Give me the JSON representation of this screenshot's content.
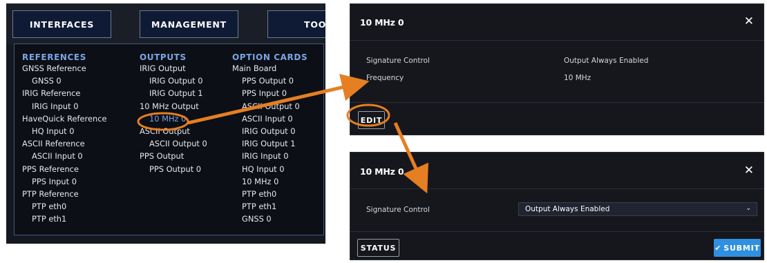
{
  "nav": {
    "tabs": [
      "INTERFACES",
      "MANAGEMENT",
      "TOO"
    ],
    "columns": [
      {
        "header": "REFERENCES",
        "items": [
          {
            "label": "GNSS Reference",
            "indent": false
          },
          {
            "label": "GNSS 0",
            "indent": true
          },
          {
            "label": "IRIG Reference",
            "indent": false
          },
          {
            "label": "IRIG Input 0",
            "indent": true
          },
          {
            "label": "HaveQuick Reference",
            "indent": false
          },
          {
            "label": "HQ Input 0",
            "indent": true
          },
          {
            "label": "ASCII Reference",
            "indent": false
          },
          {
            "label": "ASCII Input 0",
            "indent": true
          },
          {
            "label": "PPS Reference",
            "indent": false
          },
          {
            "label": "PPS Input 0",
            "indent": true
          },
          {
            "label": "PTP Reference",
            "indent": false
          },
          {
            "label": "PTP eth0",
            "indent": true
          },
          {
            "label": "PTP eth1",
            "indent": true
          }
        ]
      },
      {
        "header": "OUTPUTS",
        "items": [
          {
            "label": "IRIG Output",
            "indent": false
          },
          {
            "label": "IRIG Output 0",
            "indent": true
          },
          {
            "label": "IRIG Output 1",
            "indent": true
          },
          {
            "label": "10 MHz Output",
            "indent": false
          },
          {
            "label": "10 MHz 0",
            "indent": true,
            "active": true
          },
          {
            "label": "ASCII Output",
            "indent": false
          },
          {
            "label": "ASCII Output 0",
            "indent": true
          },
          {
            "label": "PPS Output",
            "indent": false
          },
          {
            "label": "PPS Output 0",
            "indent": true
          }
        ]
      },
      {
        "header": "OPTION CARDS",
        "items": [
          {
            "label": "Main Board",
            "indent": false
          },
          {
            "label": "PPS Output 0",
            "indent": true
          },
          {
            "label": "PPS Input 0",
            "indent": true
          },
          {
            "label": "ASCII Output 0",
            "indent": true
          },
          {
            "label": "ASCII Input 0",
            "indent": true
          },
          {
            "label": "IRIG Output 0",
            "indent": true
          },
          {
            "label": "IRIG Output 1",
            "indent": true
          },
          {
            "label": "IRIG Input 0",
            "indent": true
          },
          {
            "label": "HQ Input 0",
            "indent": true
          },
          {
            "label": "10 MHz 0",
            "indent": true
          },
          {
            "label": "PTP eth0",
            "indent": true
          },
          {
            "label": "PTP eth1",
            "indent": true
          },
          {
            "label": "GNSS 0",
            "indent": true
          }
        ]
      }
    ]
  },
  "view_dialog": {
    "title": "10 MHz 0",
    "close": "✕",
    "rows": [
      {
        "label": "Signature Control",
        "value": "Output Always Enabled"
      },
      {
        "label": "Frequency",
        "value": "10 MHz"
      }
    ],
    "edit_label": "EDIT"
  },
  "edit_dialog": {
    "title": "10 MHz 0",
    "close": "✕",
    "field_label": "Signature Control",
    "field_value": "Output Always Enabled",
    "chevron": "⌄",
    "status_label": "STATUS",
    "submit_label": "SUBMIT",
    "submit_icon": "✔"
  },
  "colors": {
    "accent_orange": "#e67e22",
    "nav_link_blue": "#7aa5e6",
    "submit_blue": "#2f8fe0"
  }
}
